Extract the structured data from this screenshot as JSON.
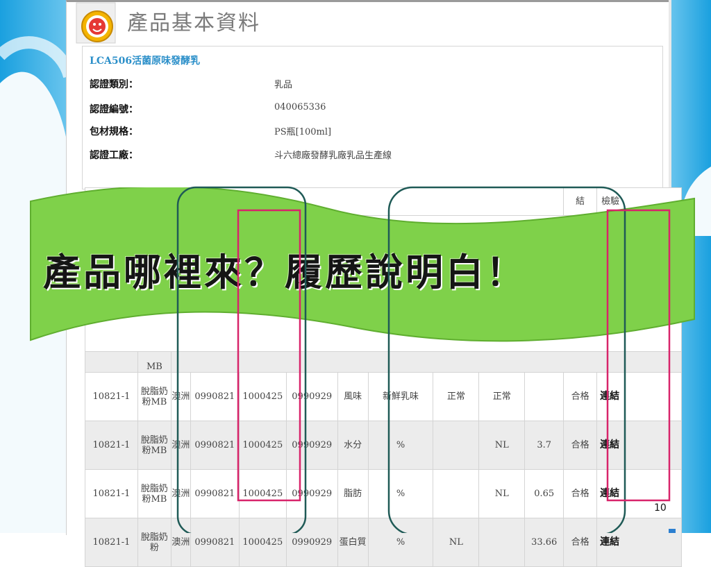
{
  "header": {
    "heading": "產品基本資料"
  },
  "product": {
    "name": "LCA506活菌原味發酵乳",
    "fields": [
      {
        "label": "認證類別：",
        "value": "乳品"
      },
      {
        "label": "認證編號：",
        "value": "040065336"
      },
      {
        "label": "包材規格：",
        "value": "PS瓶[100ml]"
      },
      {
        "label": "認證工廠：",
        "value": "斗六總廠發酵乳廠乳品生產線"
      }
    ]
  },
  "table": {
    "header_partial": [
      "結",
      "檢驗"
    ],
    "rows": [
      {
        "partial": true,
        "item_tail": "MB"
      },
      {
        "batch": "10821-1",
        "item": "脫脂奶粉MB",
        "origin": "澳洲",
        "d1": "0990821",
        "d2": "1000425",
        "d3": "0990929",
        "test": "風味",
        "standard": "新鮮乳味",
        "c1": "正常",
        "c2": "正常",
        "value": "",
        "result": "合格",
        "link": "連結"
      },
      {
        "batch": "10821-1",
        "item": "脫脂奶粉MB",
        "origin": "澳洲",
        "d1": "0990821",
        "d2": "1000425",
        "d3": "0990929",
        "test": "水分",
        "standard": "%",
        "c1": "",
        "c2": "NL",
        "value": "3.7",
        "result": "合格",
        "link": "連結"
      },
      {
        "batch": "10821-1",
        "item": "脫脂奶粉MB",
        "origin": "澳洲",
        "d1": "0990821",
        "d2": "1000425",
        "d3": "0990929",
        "test": "脂肪",
        "standard": "%",
        "c1": "",
        "c2": "NL",
        "value": "0.65",
        "result": "合格",
        "link": "連結"
      },
      {
        "batch": "10821-1",
        "item": "脫脂奶粉",
        "origin": "澳洲",
        "d1": "0990821",
        "d2": "1000425",
        "d3": "0990929",
        "test": "蛋白質",
        "standard": "%",
        "c1": "NL",
        "c2": "",
        "value": "33.66",
        "result": "合格",
        "link": "連結"
      }
    ]
  },
  "banner": {
    "text": "產品哪裡來？履歷說明白！",
    "color": "#7fd14a"
  },
  "slide": {
    "number": "10"
  },
  "colors": {
    "accent_blue": "#2b8fc9",
    "frame_teal": "#1f5a56",
    "frame_pink": "#d8246a"
  }
}
